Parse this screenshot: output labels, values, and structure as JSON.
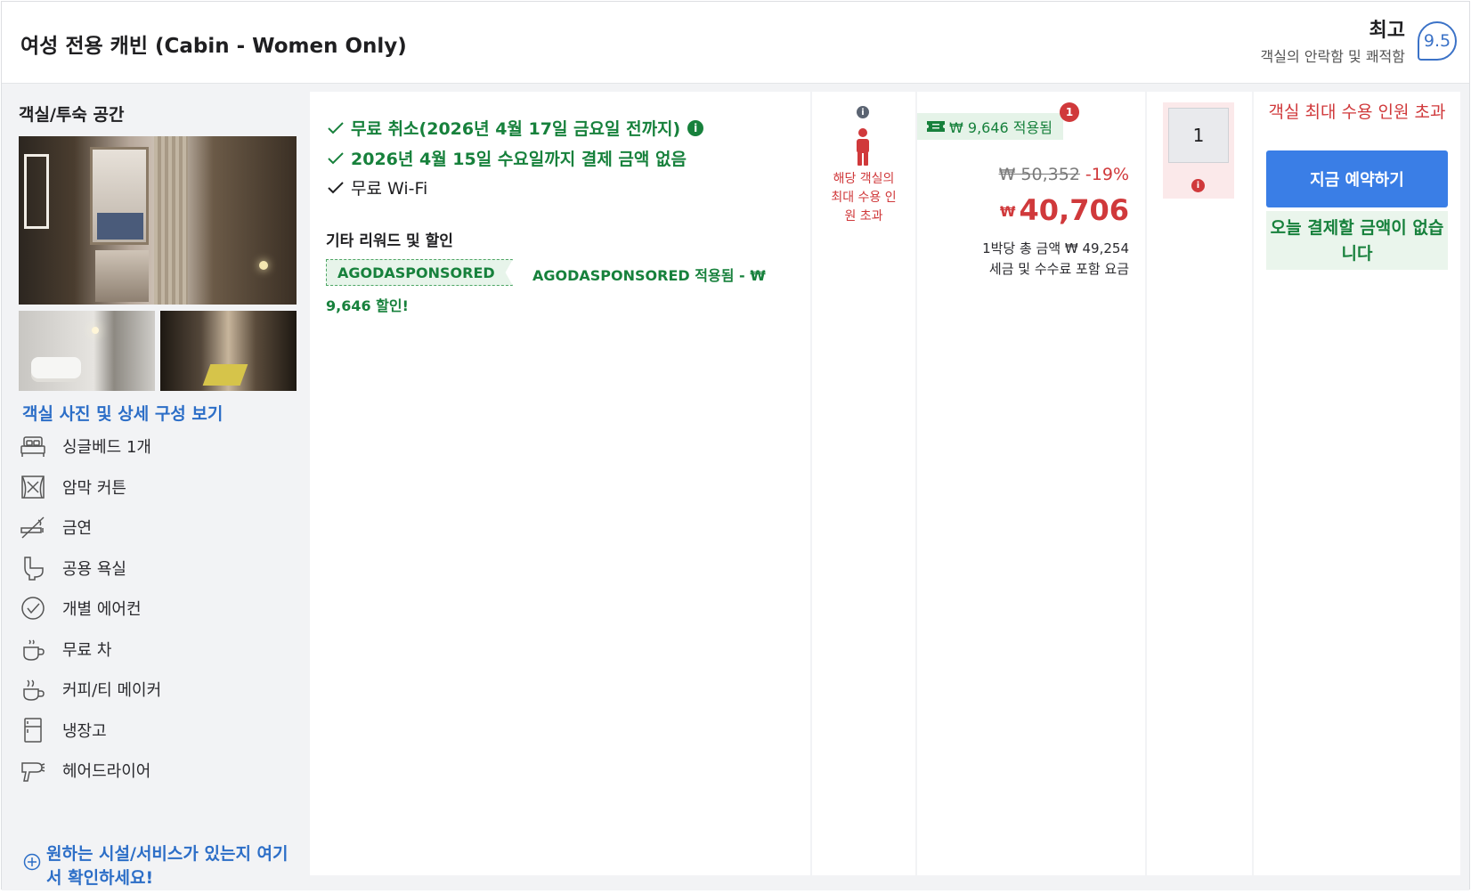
{
  "header": {
    "room_title": "여성 전용 캐빈 (Cabin - Women Only)",
    "review_word": "최고",
    "review_sub": "객실의 안락함 및 쾌적함",
    "review_score": "9.5"
  },
  "left": {
    "title": "객실/투숙 공간",
    "photo_link": "객실 사진 및 상세 구성 보기",
    "amenities": [
      {
        "label": "싱글베드 1개",
        "icon": "bed-icon"
      },
      {
        "label": "암막 커튼",
        "icon": "curtain-icon"
      },
      {
        "label": "금연",
        "icon": "no-smoking-icon"
      },
      {
        "label": "공용 욕실",
        "icon": "toilet-icon"
      },
      {
        "label": "개별 에어컨",
        "icon": "check-circle-icon"
      },
      {
        "label": "무료 차",
        "icon": "tea-icon"
      },
      {
        "label": "커피/티 메이커",
        "icon": "coffee-maker-icon"
      },
      {
        "label": "냉장고",
        "icon": "fridge-icon"
      },
      {
        "label": "헤어드라이어",
        "icon": "hairdryer-icon"
      }
    ],
    "more_link": "원하는 시설/서비스가 있는지 여기서 확인하세요!"
  },
  "benefits": {
    "items": [
      {
        "text": "무료 취소(2026년 4월 17일 금요일 전까지)",
        "style": "green"
      },
      {
        "text": "2026년 4월 15일 수요일까지 결제 금액 없음",
        "style": "green"
      },
      {
        "text": "무료 Wi-Fi",
        "style": "plain"
      }
    ],
    "info_mark": "i",
    "other_title": "기타 리워드 및 할인",
    "coupon_code": "AGODASPONSORED",
    "coupon_desc": "AGODASPONSORED 적용됨 - ₩ 9,646 할인!"
  },
  "occupancy": {
    "info_mark": "i",
    "warning": "해당 객실의 최대 수용 인원 초과"
  },
  "price": {
    "deal_badge": "₩ 9,646 적용됨",
    "deal_count": "1",
    "original": "₩ 50,352",
    "discount": "-19%",
    "currency": "₩",
    "amount": "40,706",
    "per_night_total": "1박당 총 금액 ₩ 49,254",
    "tax_note": "세금 및 수수료 포함 요금"
  },
  "quantity": {
    "value": "1",
    "error_mark": "i"
  },
  "booking": {
    "warning": "객실 최대 수용 인원 초과",
    "button": "지금 예약하기",
    "pay_today": "오늘 결제할 금액이 없습니다"
  },
  "colors": {
    "accent_blue": "#3a7ee6",
    "link_blue": "#2c6ec7",
    "green": "#17813c",
    "red": "#d0393b"
  }
}
